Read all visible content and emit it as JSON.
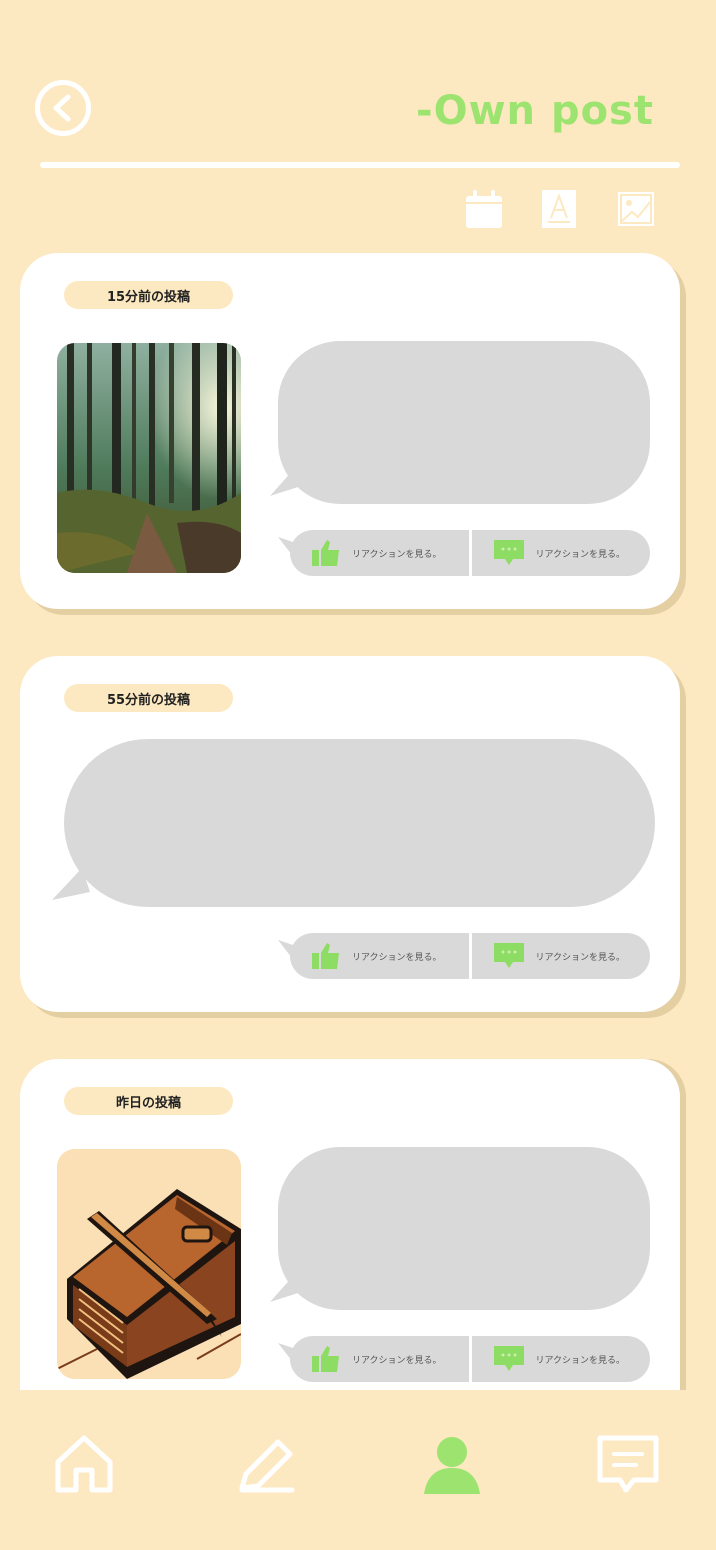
{
  "header": {
    "title": "-Own post",
    "back_icon": "chevron-left-circle-icon",
    "title_color": "#9ce36f"
  },
  "filters": [
    {
      "name": "calendar-icon"
    },
    {
      "name": "text-icon"
    },
    {
      "name": "image-icon"
    }
  ],
  "posts": [
    {
      "time_label": "15分前の投稿",
      "has_image": true,
      "image": "forest-photo",
      "like_label": "リアクションを見る。",
      "comment_label": "リアクションを見る。"
    },
    {
      "time_label": "55分前の投稿",
      "has_image": false,
      "like_label": "リアクションを見る。",
      "comment_label": "リアクションを見る。"
    },
    {
      "time_label": "昨日の投稿",
      "has_image": true,
      "image": "notebook-pen-illustration",
      "like_label": "リアクションを見る。",
      "comment_label": "リアクションを見る。"
    }
  ],
  "nav": [
    {
      "name": "home-icon",
      "active": false
    },
    {
      "name": "edit-icon",
      "active": false
    },
    {
      "name": "profile-icon",
      "active": true
    },
    {
      "name": "chat-icon",
      "active": false
    }
  ],
  "colors": {
    "background": "#fde9c1",
    "accent": "#9ce36f",
    "bubble": "#d9d9d9",
    "card": "#ffffff"
  }
}
